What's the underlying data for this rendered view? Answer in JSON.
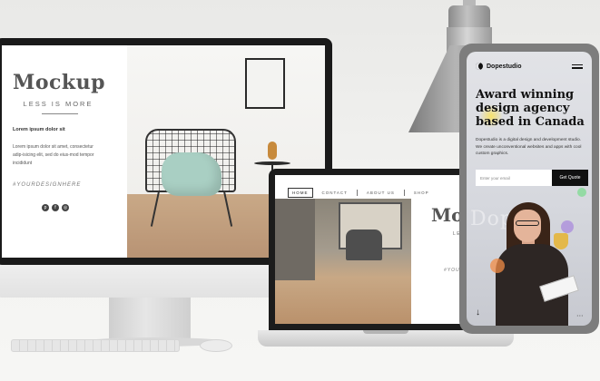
{
  "monitor": {
    "brand": "Mockup",
    "tagline": "LESS IS MORE",
    "lorem_heading": "Lorem ipsum dolor sit",
    "lorem_body": "Lorem ipsum dolor sit amet, consectetur adip-isicing elit, sed do eius-mod tempor incididunt",
    "hashtag": "#YOURDESIGNHERE",
    "social_icons": [
      "pinterest-icon",
      "facebook-icon",
      "instagram-icon"
    ]
  },
  "laptop": {
    "nav": [
      "HOME",
      "CONTACT",
      "ABOUT US",
      "SHOP"
    ],
    "brand": "Moc",
    "tagline": "LESS",
    "hashtag": "#YOUR D"
  },
  "phone": {
    "logo": "Dopestudio",
    "hero_title": "Award winning design agency based in Canada",
    "hero_desc": "Dopestudio is a digital design and  development studio. We create  unconventional websites and apps  with cool custom graphics.",
    "email_placeholder": "Enter your email",
    "cta_label": "Get Quote",
    "ghost_word": "Dope",
    "scroll_icon": "down-arrow-icon"
  },
  "colors": {
    "phone_bg": "#d6d8de",
    "cta_bg": "#111111",
    "cushion": "#a9cfc3",
    "floor": "#b89374"
  }
}
